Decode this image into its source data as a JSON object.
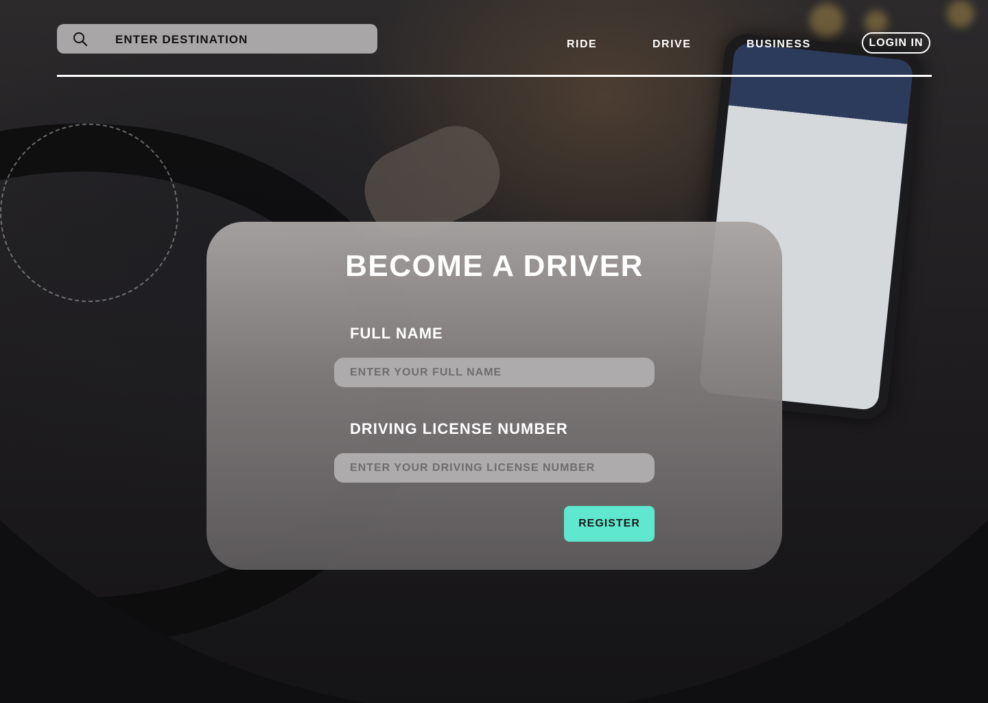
{
  "header": {
    "search": {
      "value": "ENTER DESTINATION",
      "icon": "search-icon"
    },
    "nav": [
      {
        "label": "RIDE"
      },
      {
        "label": "DRIVE"
      },
      {
        "label": "BUSINESS"
      }
    ],
    "login_label": "LOGIN IN"
  },
  "form": {
    "title": "BECOME A DRIVER",
    "full_name": {
      "label": "FULL NAME",
      "placeholder": "ENTER YOUR FULL NAME"
    },
    "license": {
      "label": "DRIVING LICENSE NUMBER",
      "placeholder": "ENTER YOUR DRIVING LICENSE NUMBER"
    },
    "submit_label": "REGISTER"
  },
  "colors": {
    "accent": "#5fe8cf",
    "card": "#8f8c8c",
    "input": "#adabab",
    "background_dark": "#0f0e10"
  }
}
